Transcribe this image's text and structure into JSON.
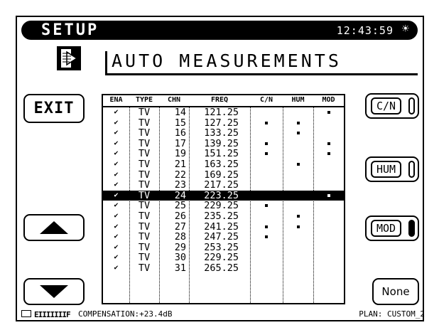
{
  "header": {
    "title": "SETUP",
    "clock": "12:43:59",
    "sun_icon": "sun-icon"
  },
  "page": {
    "title": "AUTO MEASUREMENTS"
  },
  "buttons": {
    "exit": "EXIT",
    "cn": "C/N",
    "hum": "HUM",
    "mod": "MOD",
    "none": "None",
    "up_icon": "triangle-up-icon",
    "down_icon": "triangle-down-icon"
  },
  "table": {
    "columns": [
      "ENA",
      "TYPE",
      "CHN",
      "FREQ",
      "C/N",
      "HUM",
      "MOD"
    ],
    "selected_row": 8,
    "rows": [
      {
        "ena": "✔",
        "type": "TV",
        "chn": "14",
        "freq": "121.25",
        "cn": false,
        "hum": false,
        "mod": true
      },
      {
        "ena": "✔",
        "type": "TV",
        "chn": "15",
        "freq": "127.25",
        "cn": true,
        "hum": true,
        "mod": false
      },
      {
        "ena": "✔",
        "type": "TV",
        "chn": "16",
        "freq": "133.25",
        "cn": false,
        "hum": true,
        "mod": false
      },
      {
        "ena": "✔",
        "type": "TV",
        "chn": "17",
        "freq": "139.25",
        "cn": true,
        "hum": false,
        "mod": true
      },
      {
        "ena": "✔",
        "type": "TV",
        "chn": "19",
        "freq": "151.25",
        "cn": true,
        "hum": false,
        "mod": true
      },
      {
        "ena": "✔",
        "type": "TV",
        "chn": "21",
        "freq": "163.25",
        "cn": false,
        "hum": true,
        "mod": false
      },
      {
        "ena": "✔",
        "type": "TV",
        "chn": "22",
        "freq": "169.25",
        "cn": false,
        "hum": false,
        "mod": false
      },
      {
        "ena": "✔",
        "type": "TV",
        "chn": "23",
        "freq": "217.25",
        "cn": false,
        "hum": false,
        "mod": false
      },
      {
        "ena": "✔",
        "type": "TV",
        "chn": "24",
        "freq": "223.25",
        "cn": false,
        "hum": false,
        "mod": true
      },
      {
        "ena": "✔",
        "type": "TV",
        "chn": "25",
        "freq": "229.25",
        "cn": true,
        "hum": false,
        "mod": false
      },
      {
        "ena": "✔",
        "type": "TV",
        "chn": "26",
        "freq": "235.25",
        "cn": false,
        "hum": true,
        "mod": false
      },
      {
        "ena": "✔",
        "type": "TV",
        "chn": "27",
        "freq": "241.25",
        "cn": true,
        "hum": true,
        "mod": false
      },
      {
        "ena": "✔",
        "type": "TV",
        "chn": "28",
        "freq": "247.25",
        "cn": true,
        "hum": false,
        "mod": false
      },
      {
        "ena": "✔",
        "type": "TV",
        "chn": "29",
        "freq": "253.25",
        "cn": false,
        "hum": false,
        "mod": false
      },
      {
        "ena": "✔",
        "type": "TV",
        "chn": "30",
        "freq": "229.25",
        "cn": false,
        "hum": false,
        "mod": false
      },
      {
        "ena": "✔",
        "type": "TV",
        "chn": "31",
        "freq": "265.25",
        "cn": false,
        "hum": false,
        "mod": false
      }
    ]
  },
  "status": {
    "battery_icon": "battery-icon",
    "battery_level": "EIIIIIIIF",
    "compensation": "COMPENSATION:+23.4dB",
    "plan": "PLAN: CUSTOM_2"
  },
  "colors": {
    "foreground": "#000000",
    "background": "#ffffff"
  }
}
